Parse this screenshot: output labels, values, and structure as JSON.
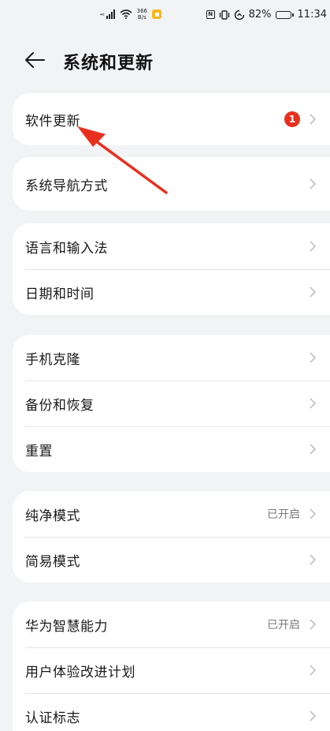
{
  "status_bar": {
    "signal_label": "⁴⁶",
    "net_speed_value": "366",
    "net_speed_unit": "B/s",
    "nfc_label": "N",
    "battery_percent": "82%",
    "battery_level": 0.82,
    "time": "11:34",
    "icons": [
      "signal-icon",
      "wifi-icon",
      "app-notification-icon",
      "nfc-icon",
      "vibrate-icon",
      "data-saver-icon",
      "battery-icon"
    ]
  },
  "header": {
    "title": "系统和更新",
    "back_icon": "arrow-left-icon"
  },
  "groups": [
    {
      "items": [
        {
          "label": "软件更新",
          "badge": "1",
          "value": ""
        }
      ]
    },
    {
      "items": [
        {
          "label": "系统导航方式",
          "value": ""
        }
      ]
    },
    {
      "items": [
        {
          "label": "语言和输入法",
          "value": ""
        },
        {
          "label": "日期和时间",
          "value": ""
        }
      ]
    },
    {
      "items": [
        {
          "label": "手机克隆",
          "value": ""
        },
        {
          "label": "备份和恢复",
          "value": ""
        },
        {
          "label": "重置",
          "value": ""
        }
      ]
    },
    {
      "items": [
        {
          "label": "纯净模式",
          "value": "已开启"
        },
        {
          "label": "简易模式",
          "value": ""
        }
      ]
    },
    {
      "items": [
        {
          "label": "华为智慧能力",
          "value": "已开启"
        },
        {
          "label": "用户体验改进计划",
          "value": ""
        },
        {
          "label": "认证标志",
          "value": ""
        }
      ]
    }
  ],
  "colors": {
    "background": "#f2f3f5",
    "card": "#ffffff",
    "badge": "#e8301f",
    "annotation_arrow": "#e8301f",
    "secondary_text": "#7a7a7a"
  }
}
